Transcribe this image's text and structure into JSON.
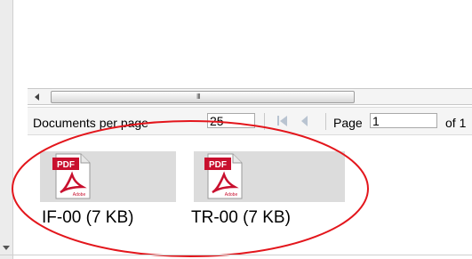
{
  "toolbar": {
    "per_page_label": "Documents per page",
    "per_page_value": "25",
    "page_label": "Page",
    "page_value": "1",
    "of_label": "of 1"
  },
  "scrollbar": {
    "grip_text": "III"
  },
  "documents": [
    {
      "name": "IF-00 (7 KB)",
      "icon_text": "PDF",
      "icon_brand": "Adobe"
    },
    {
      "name": "TR-00 (7 KB)",
      "icon_text": "PDF",
      "icon_brand": "Adobe"
    }
  ],
  "colors": {
    "annotation": "#e3161c",
    "pdf_red": "#c8102e"
  },
  "icons": {
    "document_icon": "pdf-file-icon"
  }
}
